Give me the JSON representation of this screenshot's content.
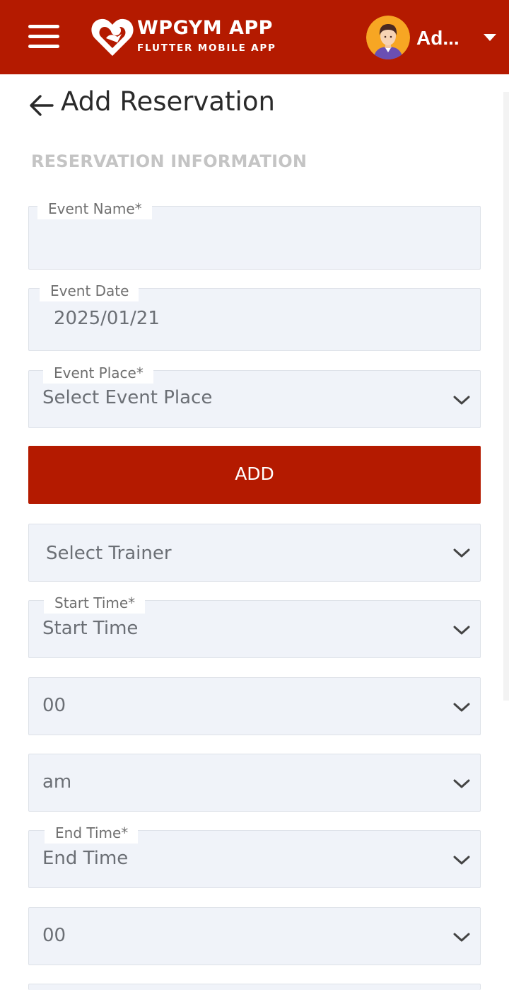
{
  "header": {
    "logo_title": "WPGYM APP",
    "logo_subtitle": "FLUTTER MOBILE APP",
    "user_name": "Ad...",
    "brand_color": "#b41a00",
    "menu_icon": "hamburger-menu-icon",
    "logo_icon": "heart-logo-icon",
    "caret_icon": "caret-down-icon"
  },
  "page": {
    "title": "Add Reservation",
    "back_icon": "arrow-left-icon",
    "section_title": "RESERVATION INFORMATION"
  },
  "form": {
    "event_name": {
      "label": "Event Name*",
      "value": ""
    },
    "event_date": {
      "label": "Event Date",
      "value": "2025/01/21"
    },
    "event_place": {
      "label": "Event Place*",
      "value": "Select Event Place"
    },
    "add_button": "ADD",
    "trainer": {
      "value": "Select Trainer"
    },
    "start_time": {
      "label": "Start Time*",
      "value": "Start Time"
    },
    "start_minute": {
      "value": "00"
    },
    "start_ampm": {
      "value": "am"
    },
    "end_time": {
      "label": "End Time*",
      "value": "End Time"
    },
    "end_minute": {
      "value": "00"
    }
  }
}
